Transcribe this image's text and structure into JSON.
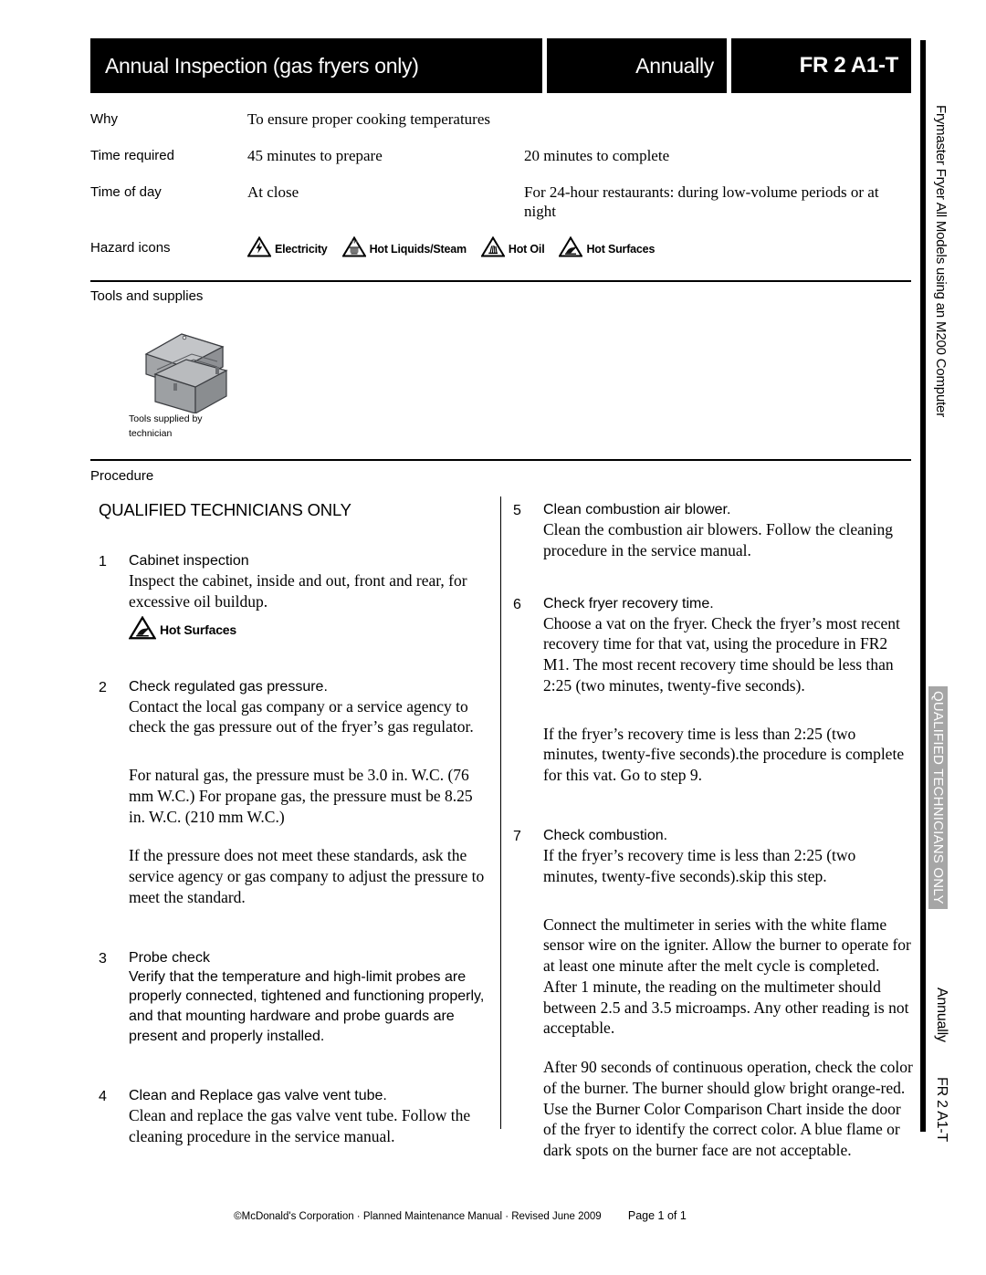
{
  "header": {
    "title": "Annual Inspection (gas fryers only)",
    "frequency": "Annually",
    "code": "FR 2 A1-T"
  },
  "sidebar": {
    "model": "Frymaster Fryer All Models using an M200 Computer",
    "qualified_tab": "QUALIFIED TECHNICIANS ONLY",
    "frequency": "Annually",
    "code": "FR 2 A1-T"
  },
  "info": {
    "rows": [
      {
        "label": "Why",
        "value1": "To ensure proper cooking temperatures",
        "value2": ""
      },
      {
        "label": "Time required",
        "value1": "45 minutes to prepare",
        "value2": "20 minutes to complete"
      },
      {
        "label": "Time of day",
        "value1": "At close",
        "value2": "For 24-hour restaurants: during low-volume periods or at night"
      }
    ],
    "hazard_label": "Hazard icons",
    "hazards": [
      {
        "icon": "electricity-hazard-icon",
        "label": "Electricity"
      },
      {
        "icon": "hot-liquids-steam-hazard-icon",
        "label": "Hot Liquids/Steam"
      },
      {
        "icon": "hot-oil-hazard-icon",
        "label": "Hot Oil"
      },
      {
        "icon": "hot-surfaces-hazard-icon",
        "label": "Hot Surfaces"
      }
    ]
  },
  "tools": {
    "heading": "Tools and supplies",
    "icon": "toolbox-icon",
    "caption": "Tools supplied by technician"
  },
  "procedure": {
    "heading": "Procedure",
    "section_title": "QUALIFIED TECHNICIANS ONLY",
    "left_steps": [
      {
        "num": "1",
        "title": "Cabinet inspection",
        "body": "Inspect the cabinet, inside and out, front and rear, for excessive oil buildup.",
        "hazard": "Hot Surfaces"
      },
      {
        "num": "2",
        "title": "Check regulated gas pressure.",
        "body": "Contact the local gas company or a service agency to check the gas pressure out of the fryer’s gas regulator.",
        "body2": "For natural gas, the pressure must be 3.0 in. W.C. (76 mm W.C.) For propane gas, the pressure must be 8.25 in. W.C. (210 mm W.C.)",
        "body3": "If the pressure does not meet these standards, ask the service agency or gas company to adjust the pressure to meet the standard."
      },
      {
        "num": "3",
        "title": "Probe check",
        "body": "Verify that the temperature and high-limit probes are properly connected, tightened and functioning properly, and that mounting hardware and probe guards are present and properly installed."
      },
      {
        "num": "4",
        "title": "Clean and Replace gas valve vent tube.",
        "body": "Clean and replace the gas valve vent tube. Follow the cleaning procedure in the service manual."
      }
    ],
    "right_steps": [
      {
        "num": "5",
        "title": "Clean combustion air blower.",
        "body": "Clean the combustion air blowers. Follow the cleaning procedure in the service manual."
      },
      {
        "num": "6",
        "title": "Check fryer recovery time.",
        "body": "Choose a vat on the fryer. Check the fryer’s most recent recovery time for that vat, using the procedure in FR2 M1. The most recent recovery time should be less than 2:25 (two minutes, twenty-five seconds).",
        "body2": "If the fryer’s recovery time is less than 2:25 (two minutes, twenty-five seconds).the procedure is complete for this vat. Go to step 9."
      },
      {
        "num": "7",
        "title": "Check combustion.",
        "body": "If the fryer’s recovery time is less than 2:25 (two minutes, twenty-five seconds).skip this step.",
        "body2": "Connect the multimeter in series with the white flame sensor wire on the igniter. Allow the burner to operate for at least one minute after the melt cycle is completed. After 1 minute, the reading on the multimeter should between 2.5 and 3.5 microamps. Any other reading is not acceptable.",
        "body3": "After 90 seconds of continuous operation, check the color of the burner. The burner should glow bright orange-red. Use the Burner Color Comparison Chart inside the door of the fryer to identify the correct color. A blue flame or dark spots on the burner face are not acceptable."
      }
    ]
  },
  "footer": {
    "text": "©McDonald's Corporation · Planned Maintenance Manual · Revised June 2009",
    "page": "Page 1 of 1"
  },
  "colors": {
    "header_bg": "#000000",
    "header_text": "#ffffff",
    "tab_bg": "#a6a6a6",
    "toolbox_body": "#9d9fa2",
    "toolbox_light": "#c2c4c7"
  }
}
